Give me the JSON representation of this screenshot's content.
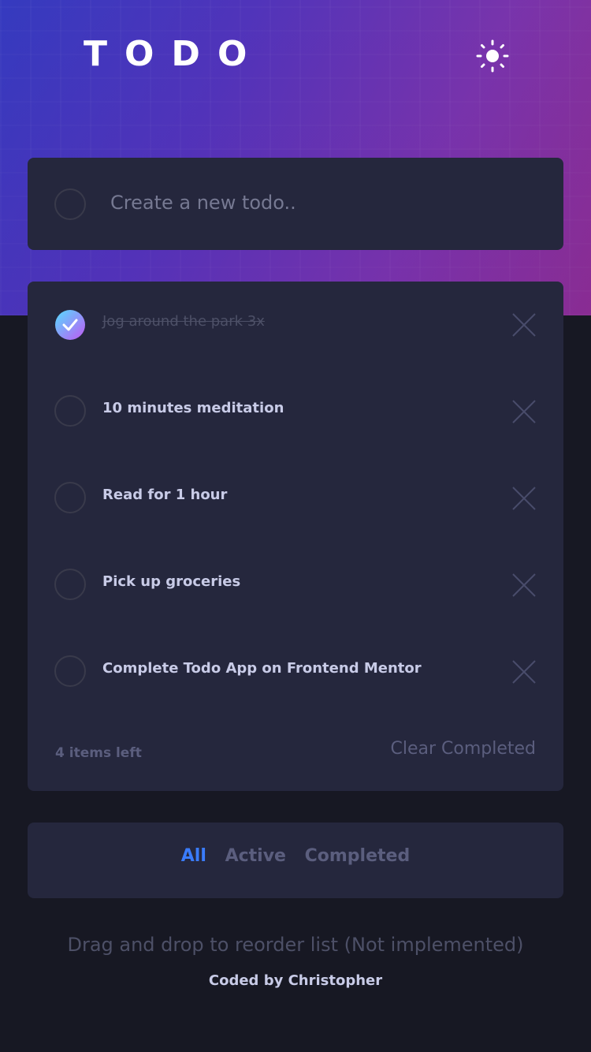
{
  "header": {
    "title": "TODO",
    "theme_icon": "sun-icon"
  },
  "create": {
    "placeholder": "Create a new todo.."
  },
  "todos": [
    {
      "text": "Jog around the park 3x",
      "completed": true
    },
    {
      "text": "10 minutes meditation",
      "completed": false
    },
    {
      "text": "Read for 1 hour",
      "completed": false
    },
    {
      "text": "Pick up groceries",
      "completed": false
    },
    {
      "text": "Complete Todo App on Frontend Mentor",
      "completed": false
    }
  ],
  "footer": {
    "items_left": "4 items left",
    "clear_label": "Clear Completed"
  },
  "filters": {
    "all": "All",
    "active": "Active",
    "completed": "Completed",
    "selected": "All"
  },
  "hint": "Drag and drop to reorder list (Not implemented)",
  "credit": "Coded by Christopher",
  "colors": {
    "accent": "#3A7CFD",
    "check_start": "#55DDFF",
    "check_end": "#C058F3",
    "card": "#25273D",
    "background": "#171823"
  }
}
